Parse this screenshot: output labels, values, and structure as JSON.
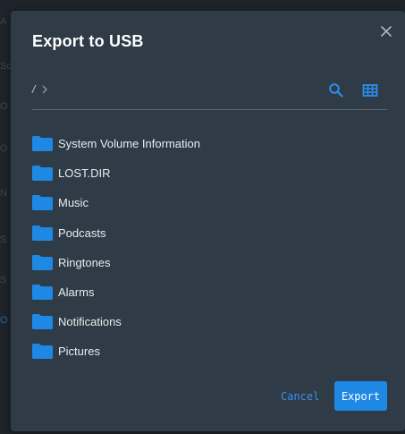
{
  "background": {
    "fragments": [
      "A",
      "Sc",
      "O",
      "O",
      "N",
      "S",
      "S",
      "O"
    ]
  },
  "dialog": {
    "title": "Export to USB",
    "path": {
      "root": "/"
    },
    "folders": [
      {
        "label": "System Volume Information",
        "icon": "folder-icon"
      },
      {
        "label": "LOST.DIR",
        "icon": "folder-icon"
      },
      {
        "label": "Music",
        "icon": "folder-icon"
      },
      {
        "label": "Podcasts",
        "icon": "folder-icon"
      },
      {
        "label": "Ringtones",
        "icon": "folder-icon"
      },
      {
        "label": "Alarms",
        "icon": "folder-icon"
      },
      {
        "label": "Notifications",
        "icon": "folder-icon"
      },
      {
        "label": "Pictures",
        "icon": "folder-icon"
      }
    ],
    "cancel_label": "Cancel",
    "export_label": "Export",
    "icons": {
      "close": "close-icon",
      "search": "search-icon",
      "view": "grid-view-icon",
      "path_separator": "chevron-right-icon"
    }
  },
  "colors": {
    "dialog_bg": "#2f3b46",
    "accent": "#1e88e5",
    "folder": "#1e88e5",
    "text": "#e8edf1"
  }
}
